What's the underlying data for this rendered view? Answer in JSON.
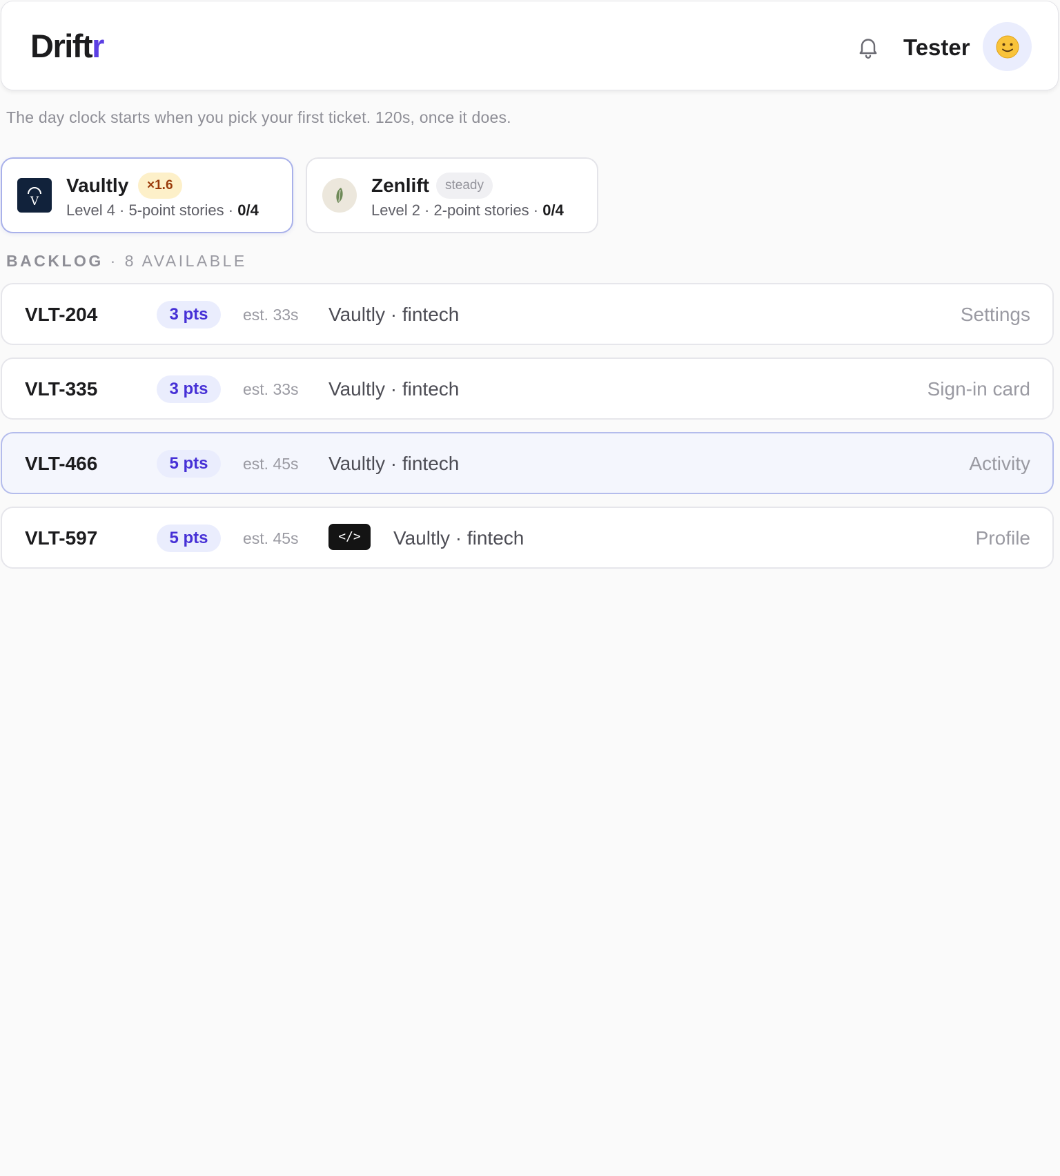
{
  "header": {
    "logo_main": "Drift",
    "logo_accent": "r",
    "bell_icon": "bell-icon",
    "username": "Tester",
    "avatar_emoji": "🙂",
    "accent_color": "#5b3fe3"
  },
  "hint": "The day clock starts when you pick your first ticket. 120s, once it does.",
  "clients": [
    {
      "name": "Vaultly",
      "badge": "×1.6",
      "meta_prefix": "Level 4 · 5-point stories · ",
      "progress": "0/4",
      "logo_icon": "vault-logo-icon",
      "active": true
    },
    {
      "name": "Zenlift",
      "badge": "steady",
      "meta_prefix": "Level 2 · 2-point stories · ",
      "progress": "0/4",
      "logo_icon": "leaf-logo-icon",
      "active": false
    }
  ],
  "backlog": {
    "label": "BACKLOG",
    "count_text": "· 8 AVAILABLE",
    "tickets": [
      {
        "id": "VLT-204",
        "points": "3 pts",
        "estimate": "est. 33s",
        "project": "Vaultly · fintech",
        "area": "Settings",
        "selected": false,
        "code_badge": ""
      },
      {
        "id": "VLT-335",
        "points": "3 pts",
        "estimate": "est. 33s",
        "project": "Vaultly · fintech",
        "area": "Sign-in card",
        "selected": false,
        "code_badge": ""
      },
      {
        "id": "VLT-466",
        "points": "5 pts",
        "estimate": "est. 45s",
        "project": "Vaultly · fintech",
        "area": "Activity",
        "selected": true,
        "code_badge": ""
      },
      {
        "id": "VLT-597",
        "points": "5 pts",
        "estimate": "est. 45s",
        "project": "Vaultly · fintech",
        "area": "Profile",
        "selected": false,
        "code_badge": "</>"
      }
    ]
  }
}
